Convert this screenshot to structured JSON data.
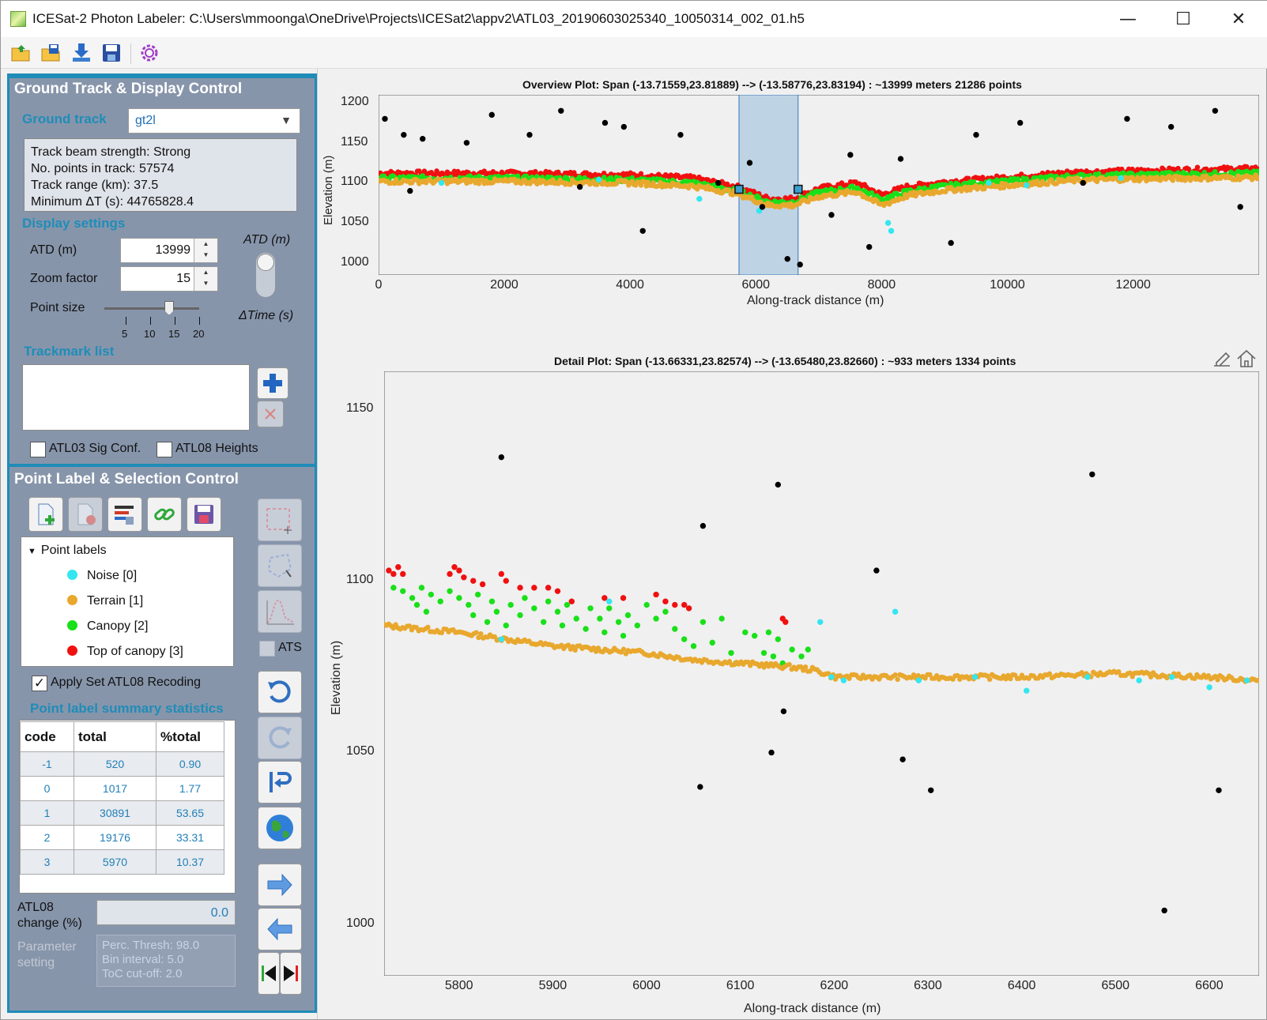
{
  "window": {
    "title": "ICESat-2 Photon Labeler: C:\\Users\\mmoonga\\OneDrive\\Projects\\ICESat2\\appv2\\ATL03_20190603025340_10050314_002_01.h5",
    "minimize": "—",
    "maximize": "☐",
    "close": "✕"
  },
  "ground_panel": {
    "header": "Ground Track & Display Control",
    "ground_track_label": "Ground track",
    "ground_track_value": "gt2l",
    "info": [
      "Track beam strength:  Strong",
      "No. points in track:  57574",
      "Track range (km):  37.5",
      "Minimum ΔT (s):  44765828.4"
    ],
    "display_settings": "Display settings",
    "atd_label": "ATD (m)",
    "atd_value": "13999",
    "zoom_label": "Zoom factor",
    "zoom_value": "15",
    "point_size_label": "Point size",
    "point_size_value": 15,
    "slider_ticks": [
      "5",
      "10",
      "15",
      "20"
    ],
    "toggle_top": "ATD (m)",
    "toggle_bottom": "ΔTime (s)",
    "trackmark_label": "Trackmark list",
    "atl03_check": "ATL03 Sig Conf.",
    "atl08_check": "ATL08 Heights"
  },
  "label_panel": {
    "header": "Point Label & Selection Control",
    "tree_root": "Point labels",
    "labels": [
      {
        "name": "Noise [0]",
        "color": "#33e6f0"
      },
      {
        "name": "Terrain [1]",
        "color": "#e8a82e"
      },
      {
        "name": "Canopy [2]",
        "color": "#19e019"
      },
      {
        "name": "Top of canopy [3]",
        "color": "#f01010"
      }
    ],
    "apply_check": "Apply Set ATL08 Recoding",
    "apply_checked": "✓",
    "stats_title": "Point label summary statistics",
    "stats_headers": [
      "code",
      "total",
      "%total"
    ],
    "stats_rows": [
      [
        "-1",
        "520",
        "0.90"
      ],
      [
        "0",
        "1017",
        "1.77"
      ],
      [
        "1",
        "30891",
        "53.65"
      ],
      [
        "2",
        "19176",
        "33.31"
      ],
      [
        "3",
        "5970",
        "10.37"
      ]
    ],
    "atl08_change_label": "ATL08\nchange (%)",
    "atl08_change_value": "0.0",
    "param_label": "Parameter\nsetting",
    "param_lines": [
      "Perc. Thresh:  98.0",
      "Bin interval:  5.0",
      "ToC cut-off:  2.0"
    ],
    "ats_label": "ATS"
  },
  "overview": {
    "title": "Overview Plot: Span (-13.71559,23.81889) --> (-13.58776,23.83194) : ~13999 meters 21286 points",
    "xlabel": "Along-track distance (m)",
    "ylabel": "Elevation (m)",
    "xticks": [
      "0",
      "2000",
      "4000",
      "6000",
      "8000",
      "10000",
      "12000"
    ],
    "yticks": [
      "1200",
      "1150",
      "1100",
      "1050",
      "1000"
    ]
  },
  "detail": {
    "title": "Detail  Plot:  Span  (-13.66331,23.82574)  -->  (-13.65480,23.82660)  :  ~933  meters  1334  points",
    "xlabel": "Along-track distance (m)",
    "ylabel": "Elevation (m)",
    "xticks": [
      "5800",
      "5900",
      "6000",
      "6100",
      "6200",
      "6300",
      "6400",
      "6500",
      "6600"
    ],
    "yticks": [
      "1150",
      "1100",
      "1050",
      "1000"
    ]
  },
  "chart_data": [
    {
      "type": "scatter",
      "title": "Overview Plot: Span (-13.71559,23.81889) --> (-13.58776,23.83194) : ~13999 meters 21286 points",
      "xlabel": "Along-track distance (m)",
      "ylabel": "Elevation (m)",
      "xlim": [
        0,
        13999
      ],
      "ylim": [
        985,
        1210
      ],
      "selection_span": [
        5730,
        6670
      ],
      "series": [
        {
          "name": "Top of canopy [3]",
          "color": "#f01010",
          "profile": [
            [
              0,
              1112
            ],
            [
              2000,
              1112
            ],
            [
              4000,
              1110
            ],
            [
              5000,
              1106
            ],
            [
              5700,
              1095
            ],
            [
              6200,
              1080
            ],
            [
              6600,
              1080
            ],
            [
              7000,
              1093
            ],
            [
              7600,
              1100
            ],
            [
              8000,
              1085
            ],
            [
              8400,
              1095
            ],
            [
              9000,
              1101
            ],
            [
              10000,
              1107
            ],
            [
              11000,
              1113
            ],
            [
              12000,
              1115
            ],
            [
              13999,
              1118
            ]
          ]
        },
        {
          "name": "Canopy [2]",
          "color": "#19e019",
          "profile": [
            [
              0,
              1106
            ],
            [
              2000,
              1106
            ],
            [
              4000,
              1104
            ],
            [
              5000,
              1100
            ],
            [
              5700,
              1090
            ],
            [
              6200,
              1076
            ],
            [
              6600,
              1076
            ],
            [
              7000,
              1088
            ],
            [
              7600,
              1094
            ],
            [
              8000,
              1079
            ],
            [
              8400,
              1089
            ],
            [
              9000,
              1096
            ],
            [
              10000,
              1102
            ],
            [
              11000,
              1108
            ],
            [
              12000,
              1110
            ],
            [
              13999,
              1112
            ]
          ]
        },
        {
          "name": "Terrain [1]",
          "color": "#e8a82e",
          "profile": [
            [
              0,
              1102
            ],
            [
              2000,
              1102
            ],
            [
              4000,
              1100
            ],
            [
              5000,
              1096
            ],
            [
              5700,
              1087
            ],
            [
              6200,
              1072
            ],
            [
              6600,
              1072
            ],
            [
              7000,
              1083
            ],
            [
              7600,
              1089
            ],
            [
              8000,
              1072
            ],
            [
              8400,
              1084
            ],
            [
              9000,
              1091
            ],
            [
              10000,
              1097
            ],
            [
              11000,
              1103
            ],
            [
              12000,
              1105
            ],
            [
              13999,
              1107
            ]
          ]
        },
        {
          "name": "Noise [0]",
          "color": "#33e6f0",
          "points": [
            [
              1000,
              1100
            ],
            [
              3500,
              1104
            ],
            [
              5100,
              1080
            ],
            [
              6050,
              1065
            ],
            [
              8100,
              1050
            ],
            [
              8150,
              1040
            ],
            [
              9700,
              1100
            ],
            [
              10300,
              1097
            ],
            [
              11800,
              1106
            ]
          ]
        },
        {
          "name": "-1",
          "color": "#000000",
          "points": [
            [
              100,
              1180
            ],
            [
              400,
              1160
            ],
            [
              500,
              1090
            ],
            [
              700,
              1155
            ],
            [
              1400,
              1150
            ],
            [
              1800,
              1185
            ],
            [
              2400,
              1160
            ],
            [
              2900,
              1190
            ],
            [
              3200,
              1095
            ],
            [
              3600,
              1175
            ],
            [
              3900,
              1170
            ],
            [
              4200,
              1040
            ],
            [
              4800,
              1160
            ],
            [
              5400,
              1100
            ],
            [
              5900,
              1125
            ],
            [
              6100,
              1070
            ],
            [
              6500,
              1005
            ],
            [
              6700,
              998
            ],
            [
              7200,
              1060
            ],
            [
              7500,
              1135
            ],
            [
              7800,
              1020
            ],
            [
              8300,
              1130
            ],
            [
              9100,
              1025
            ],
            [
              9500,
              1160
            ],
            [
              10200,
              1175
            ],
            [
              11200,
              1100
            ],
            [
              11900,
              1180
            ],
            [
              12600,
              1170
            ],
            [
              13300,
              1190
            ],
            [
              13700,
              1070
            ]
          ]
        }
      ]
    },
    {
      "type": "scatter",
      "title": "Detail  Plot:  Span  (-13.66331,23.82574)  -->  (-13.65480,23.82660)  :  ~933  meters  1334  points",
      "xlabel": "Along-track distance (m)",
      "ylabel": "Elevation (m)",
      "xlim": [
        5720,
        6653
      ],
      "ylim": [
        985,
        1161
      ],
      "series": [
        {
          "name": "Top of canopy [3]",
          "color": "#f01010",
          "points": [
            [
              5725,
              1103
            ],
            [
              5730,
              1102
            ],
            [
              5735,
              1104
            ],
            [
              5740,
              1102
            ],
            [
              5790,
              1102
            ],
            [
              5795,
              1104
            ],
            [
              5800,
              1103
            ],
            [
              5805,
              1101
            ],
            [
              5815,
              1100
            ],
            [
              5825,
              1099
            ],
            [
              5845,
              1102
            ],
            [
              5850,
              1100
            ],
            [
              5865,
              1098
            ],
            [
              5880,
              1098
            ],
            [
              5895,
              1098
            ],
            [
              5905,
              1097
            ],
            [
              5920,
              1094
            ],
            [
              5955,
              1095
            ],
            [
              5975,
              1095
            ],
            [
              6010,
              1096
            ],
            [
              6020,
              1094
            ],
            [
              6030,
              1093
            ],
            [
              6040,
              1093
            ],
            [
              6045,
              1092
            ],
            [
              6145,
              1089
            ],
            [
              6148,
              1088
            ]
          ]
        },
        {
          "name": "Canopy [2]",
          "color": "#19e019",
          "points": [
            [
              5730,
              1098
            ],
            [
              5740,
              1097
            ],
            [
              5750,
              1095
            ],
            [
              5755,
              1093
            ],
            [
              5760,
              1098
            ],
            [
              5765,
              1091
            ],
            [
              5770,
              1096
            ],
            [
              5780,
              1094
            ],
            [
              5790,
              1097
            ],
            [
              5800,
              1095
            ],
            [
              5810,
              1093
            ],
            [
              5815,
              1090
            ],
            [
              5820,
              1096
            ],
            [
              5830,
              1088
            ],
            [
              5835,
              1094
            ],
            [
              5840,
              1091
            ],
            [
              5850,
              1087
            ],
            [
              5855,
              1093
            ],
            [
              5865,
              1090
            ],
            [
              5870,
              1095
            ],
            [
              5880,
              1092
            ],
            [
              5890,
              1088
            ],
            [
              5895,
              1094
            ],
            [
              5905,
              1091
            ],
            [
              5910,
              1087
            ],
            [
              5915,
              1093
            ],
            [
              5925,
              1089
            ],
            [
              5935,
              1086
            ],
            [
              5940,
              1092
            ],
            [
              5950,
              1089
            ],
            [
              5955,
              1085
            ],
            [
              5960,
              1092
            ],
            [
              5970,
              1088
            ],
            [
              5975,
              1084
            ],
            [
              5980,
              1090
            ],
            [
              5990,
              1087
            ],
            [
              6000,
              1093
            ],
            [
              6010,
              1089
            ],
            [
              6020,
              1091
            ],
            [
              6030,
              1086
            ],
            [
              6040,
              1083
            ],
            [
              6050,
              1081
            ],
            [
              6060,
              1088
            ],
            [
              6070,
              1082
            ],
            [
              6080,
              1089
            ],
            [
              6090,
              1079
            ],
            [
              6095,
              1076
            ],
            [
              6105,
              1085
            ],
            [
              6115,
              1084
            ],
            [
              6125,
              1079
            ],
            [
              6130,
              1085
            ],
            [
              6135,
              1078
            ],
            [
              6140,
              1083
            ],
            [
              6145,
              1076
            ],
            [
              6155,
              1080
            ],
            [
              6165,
              1078
            ],
            [
              6172,
              1080
            ]
          ]
        },
        {
          "name": "Terrain [1]",
          "color": "#e8a82e",
          "profile": [
            [
              5720,
              1087
            ],
            [
              5760,
              1086
            ],
            [
              5800,
              1085
            ],
            [
              5850,
              1083
            ],
            [
              5900,
              1081
            ],
            [
              5950,
              1080
            ],
            [
              6000,
              1079
            ],
            [
              6050,
              1077
            ],
            [
              6100,
              1076
            ],
            [
              6150,
              1075
            ],
            [
              6180,
              1074
            ],
            [
              6200,
              1072
            ],
            [
              6250,
              1072
            ],
            [
              6300,
              1072
            ],
            [
              6400,
              1072
            ],
            [
              6500,
              1073
            ],
            [
              6600,
              1072
            ],
            [
              6653,
              1071
            ]
          ]
        },
        {
          "name": "Noise [0]",
          "color": "#33e6f0",
          "points": [
            [
              5845,
              1083
            ],
            [
              5960,
              1094
            ],
            [
              6185,
              1088
            ],
            [
              6197,
              1072
            ],
            [
              6210,
              1071
            ],
            [
              6265,
              1091
            ],
            [
              6290,
              1071
            ],
            [
              6350,
              1072
            ],
            [
              6405,
              1068
            ],
            [
              6470,
              1072
            ],
            [
              6525,
              1071
            ],
            [
              6560,
              1072
            ],
            [
              6600,
              1069
            ],
            [
              6640,
              1071
            ]
          ]
        },
        {
          "name": "-1",
          "color": "#000000",
          "points": [
            [
              5845,
              1136
            ],
            [
              6060,
              1116
            ],
            [
              6140,
              1128
            ],
            [
              6245,
              1103
            ],
            [
              6475,
              1131
            ],
            [
              6133,
              1050
            ],
            [
              6146,
              1062
            ],
            [
              6057,
              1040
            ],
            [
              6273,
              1048
            ],
            [
              6303,
              1039
            ],
            [
              6610,
              1039
            ],
            [
              6552,
              1004
            ]
          ]
        }
      ]
    }
  ]
}
